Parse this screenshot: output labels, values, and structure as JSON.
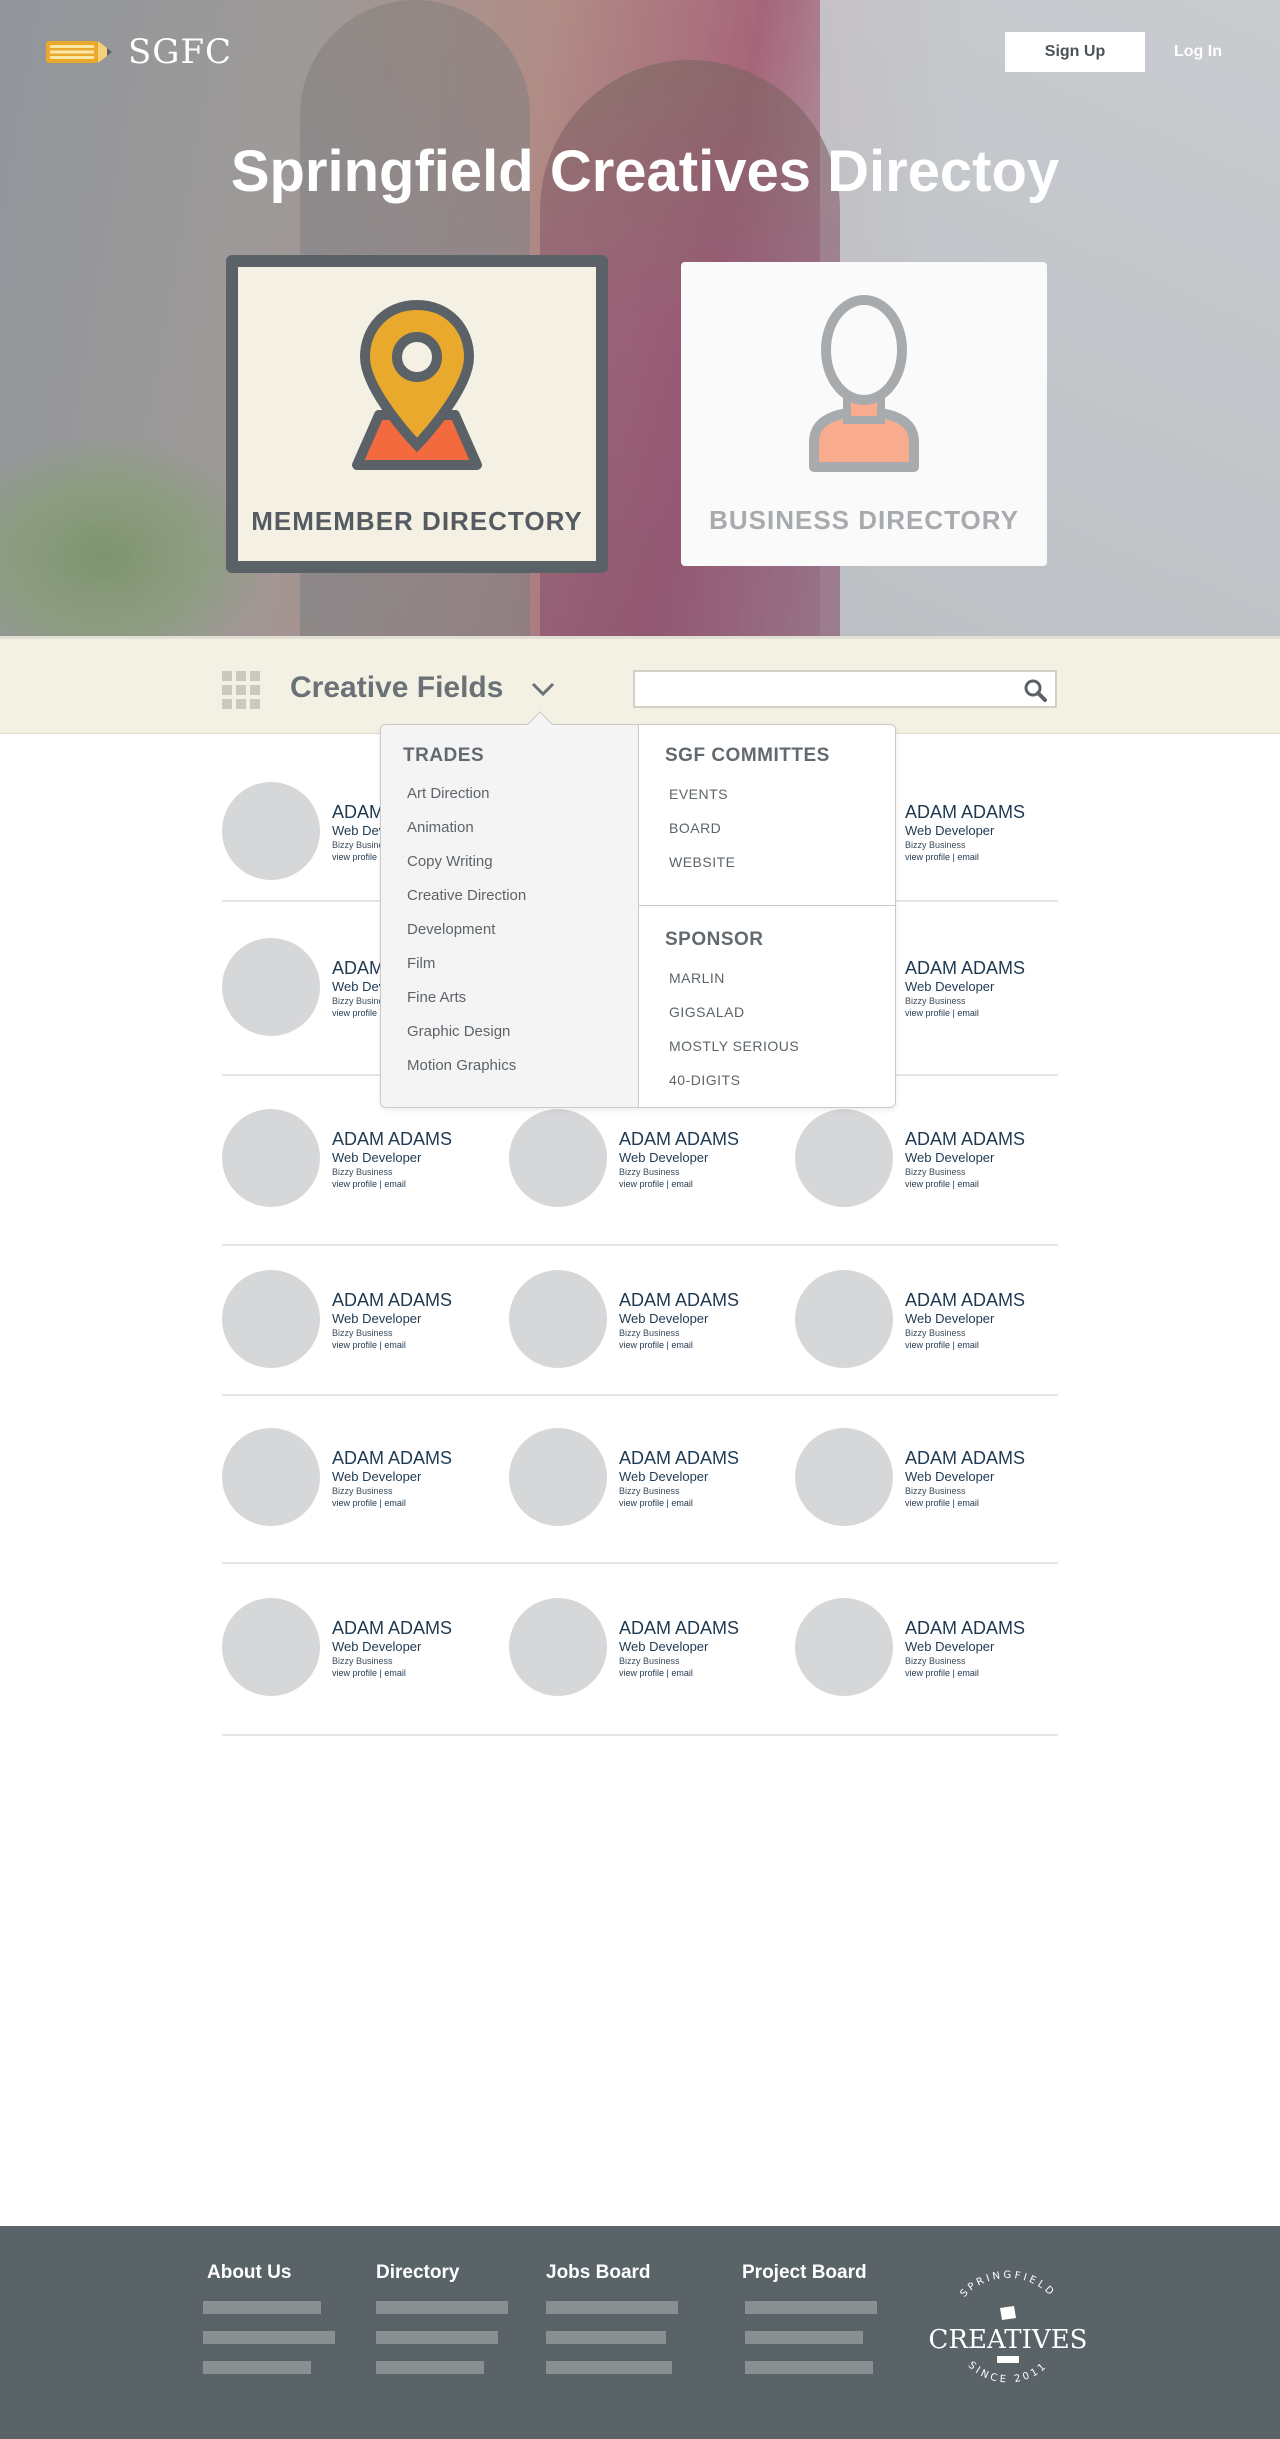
{
  "header": {
    "logo_text": "SGFC",
    "signup_label": "Sign Up",
    "login_label": "Log In"
  },
  "hero": {
    "title": "Springfield Creatives Directoy",
    "member_card_label": "MEMEMBER DIRECTORY",
    "business_card_label": "BUSINESS DIRECTORY"
  },
  "filter": {
    "fields_label": "Creative Fields",
    "search_placeholder": ""
  },
  "dropdown": {
    "trades_heading": "TRADES",
    "trades": [
      "Art Direction",
      "Animation",
      "Copy Writing",
      "Creative Direction",
      "Development",
      "Film",
      "Fine Arts",
      "Graphic Design",
      "Motion Graphics"
    ],
    "committees_heading": "SGF COMMITTES",
    "committees": [
      "EVENTS",
      "BOARD",
      "WEBSITE"
    ],
    "sponsor_heading": "SPONSOR",
    "sponsors": [
      "MARLIN",
      "GIGSALAD",
      "MOSTLY SERIOUS",
      "40-DIGITS"
    ]
  },
  "member": {
    "name": "ADAM ADAMS",
    "role": "Web Developer",
    "business": "Bizzy Business",
    "view_profile": "view profile",
    "separator": " | ",
    "email": "email"
  },
  "footer": {
    "about": "About Us",
    "directory": "Directory",
    "jobs": "Jobs Board",
    "projects": "Project Board",
    "badge_top": "SPRINGFIELD",
    "badge_main": "CREATIVES",
    "badge_bottom": "SINCE 2011"
  },
  "colors": {
    "accent_orange": "#e8a92c",
    "pin_base": "#f26a3d",
    "dark_slate": "#5a6268",
    "link_navy": "#1f3a52"
  }
}
